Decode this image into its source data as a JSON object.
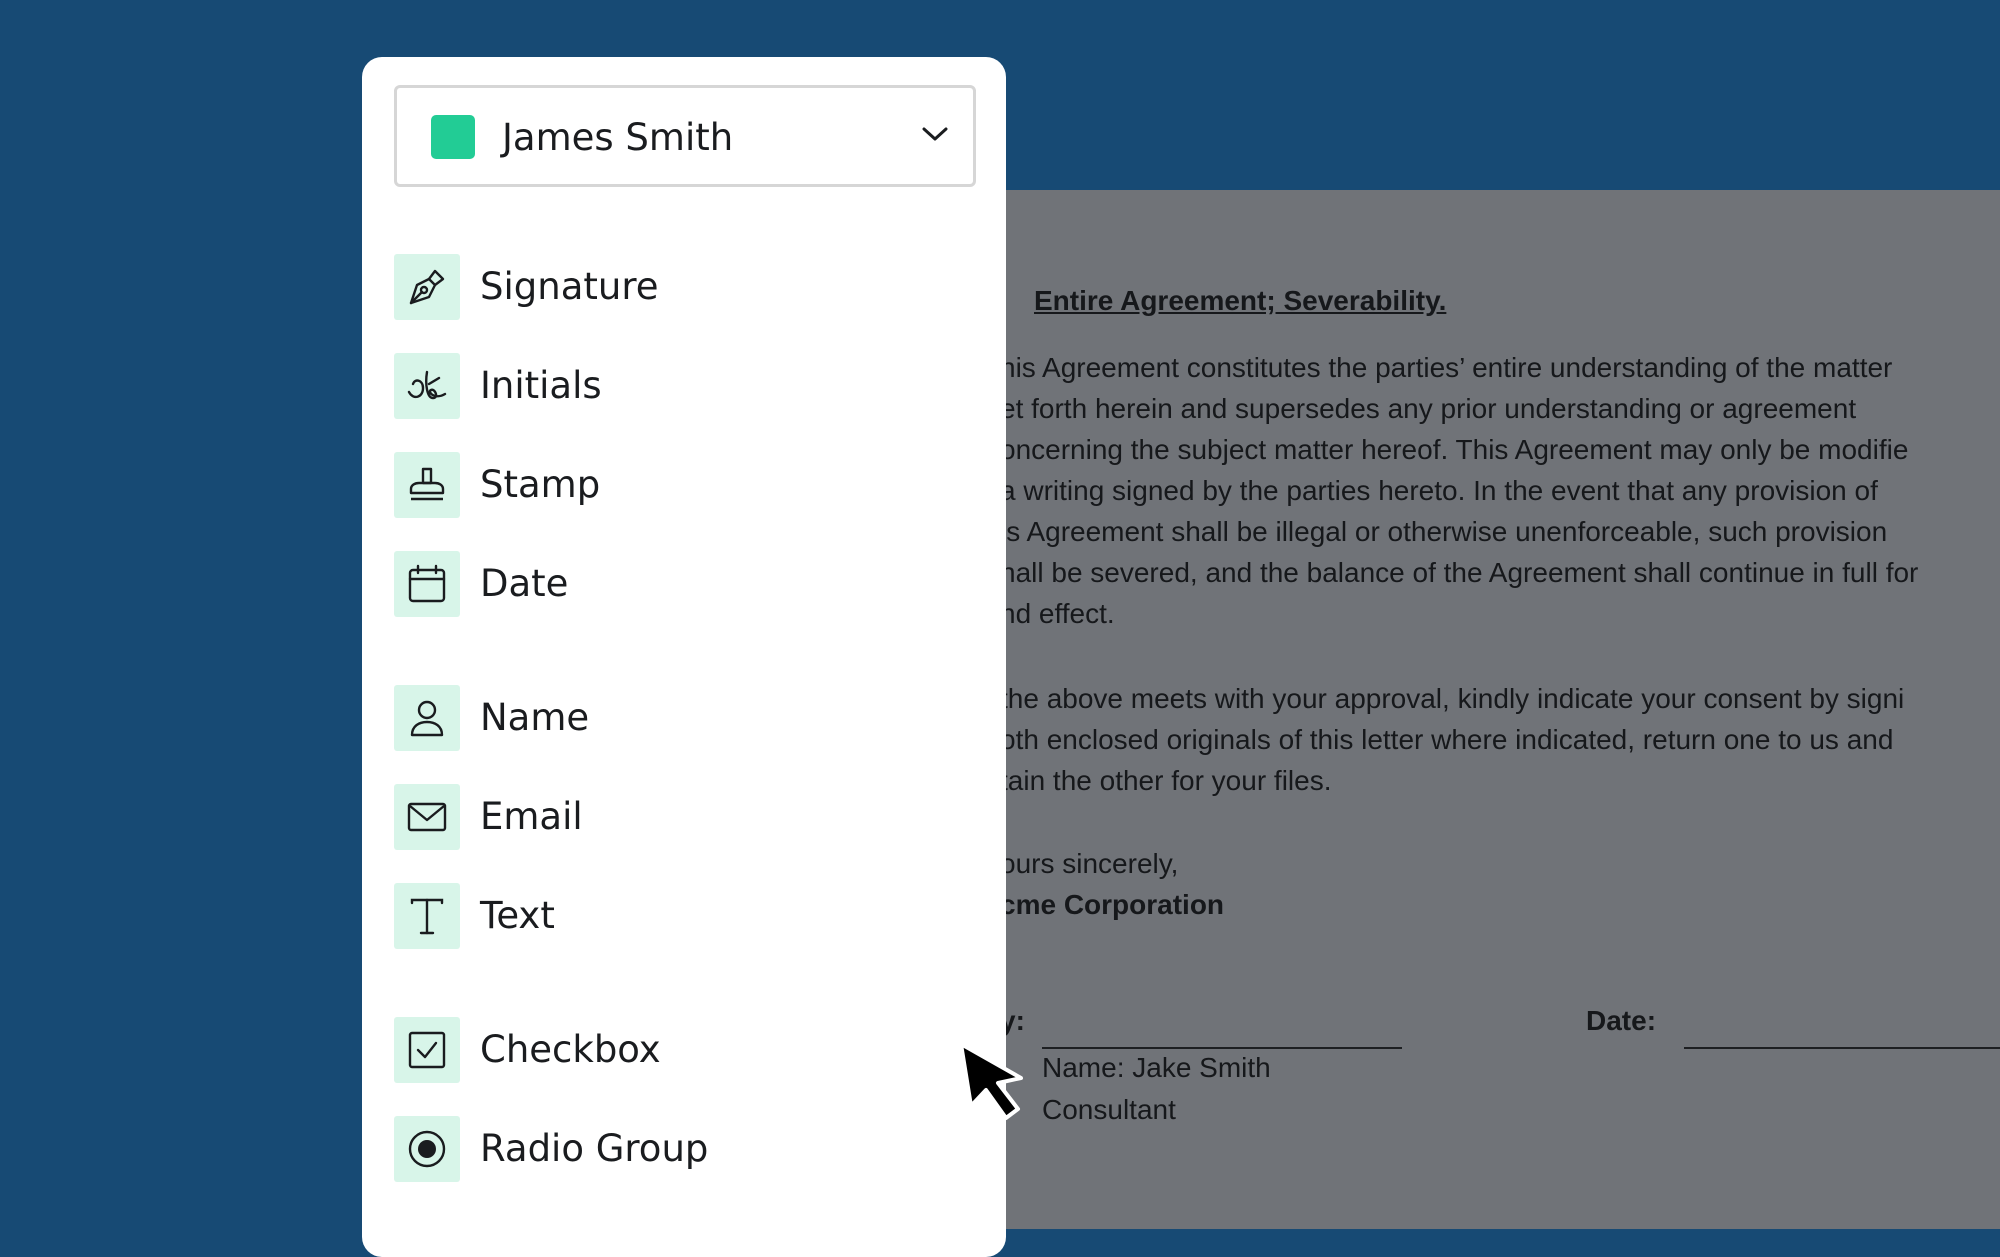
{
  "recipient": {
    "name": "James Smith",
    "color": "#22cc95"
  },
  "fields": [
    {
      "label": "Signature",
      "icon": "pen-nib-icon"
    },
    {
      "label": "Initials",
      "icon": "initials-scribble-icon"
    },
    {
      "label": "Stamp",
      "icon": "stamp-icon"
    },
    {
      "label": "Date",
      "icon": "calendar-icon"
    },
    {
      "label": "Name",
      "icon": "person-icon"
    },
    {
      "label": "Email",
      "icon": "envelope-icon"
    },
    {
      "label": "Text",
      "icon": "text-t-icon"
    },
    {
      "label": "Checkbox",
      "icon": "checkbox-icon"
    },
    {
      "label": "Radio Group",
      "icon": "radio-icon"
    }
  ],
  "document": {
    "section_number": "",
    "section_title": "Entire Agreement; Severability.",
    "paragraph1": [
      "his Agreement constitutes the  parties’ entire understanding of the matter",
      "et forth herein and supersedes any prior understanding or agreement",
      "oncerning the subject matter hereof. This Agreement may only be modifie",
      " a writing signed by the parties hereto. In the event that any provision of",
      "is Agreement shall be illegal or otherwise unenforceable, such provision",
      "hall be severed, and the balance of the Agreement shall continue in full for",
      "nd effect."
    ],
    "paragraph2": [
      " the above meets with your approval, kindly indicate your consent by signi",
      "oth enclosed originals of this letter where indicated, return one to us and",
      "tain the other for your files."
    ],
    "closing": "ours sincerely,",
    "company": "cme Corporation",
    "by_label": "y:",
    "date_label": "Date:",
    "signer_name": "Name: Jake Smith",
    "signer_title": "Consultant"
  },
  "colors": {
    "background": "#174a74",
    "document_overlay": "#707378",
    "icon_tile": "#d8f5e9"
  }
}
